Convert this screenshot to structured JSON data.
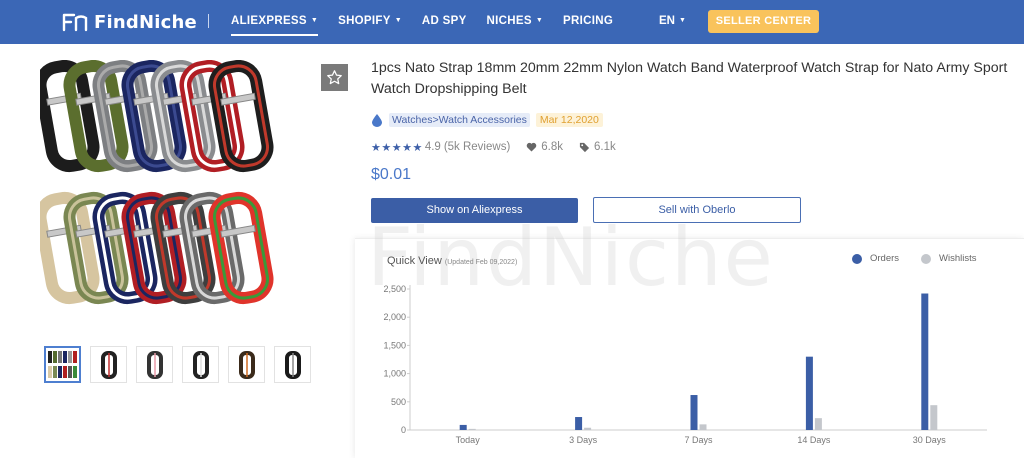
{
  "header": {
    "logo_text": "FindNiche",
    "nav": [
      {
        "label": "ALIEXPRESS",
        "caret": true,
        "active": true
      },
      {
        "label": "SHOPIFY",
        "caret": true,
        "active": false
      },
      {
        "label": "AD SPY",
        "caret": false,
        "active": false
      },
      {
        "label": "NICHES",
        "caret": true,
        "active": false
      },
      {
        "label": "PRICING",
        "caret": false,
        "active": false
      }
    ],
    "lang": "EN",
    "seller_button": "SELLER CENTER",
    "bg_color": "#3b67b6",
    "seller_color": "#f9c35c"
  },
  "product": {
    "title": "1pcs Nato Strap 18mm 20mm 22mm Nylon Watch Band Waterproof Watch Strap for Nato Army Sport Watch Dropshipping Belt",
    "category": "Watches>Watch Accessories",
    "date": "Mar 12,2020",
    "rating": "4.9",
    "reviews": "(5k Reviews)",
    "likes": "6.8k",
    "tags": "6.1k",
    "price": "$0.01",
    "show_button": "Show on Aliexpress",
    "sell_button": "Sell with Oberlo",
    "thumbnail_count": 6
  },
  "watermark": "FindNiche",
  "quick_view": {
    "title": "Quick View",
    "updated": "(Updated Feb 09,2022)"
  },
  "chart_data": {
    "type": "bar",
    "categories": [
      "Today",
      "3 Days",
      "7 Days",
      "14 Days",
      "30 Days"
    ],
    "series": [
      {
        "name": "Orders",
        "color": "#3b5ea6",
        "values": [
          90,
          230,
          620,
          1300,
          2420
        ]
      },
      {
        "name": "Wishlists",
        "color": "#c4c7cc",
        "values": [
          20,
          40,
          100,
          210,
          440
        ]
      }
    ],
    "yticks": [
      "0",
      "500",
      "1,000",
      "1,500",
      "2,000",
      "2,500"
    ],
    "ylim": [
      0,
      2500
    ],
    "grid": false,
    "legend_position": "top-right"
  }
}
